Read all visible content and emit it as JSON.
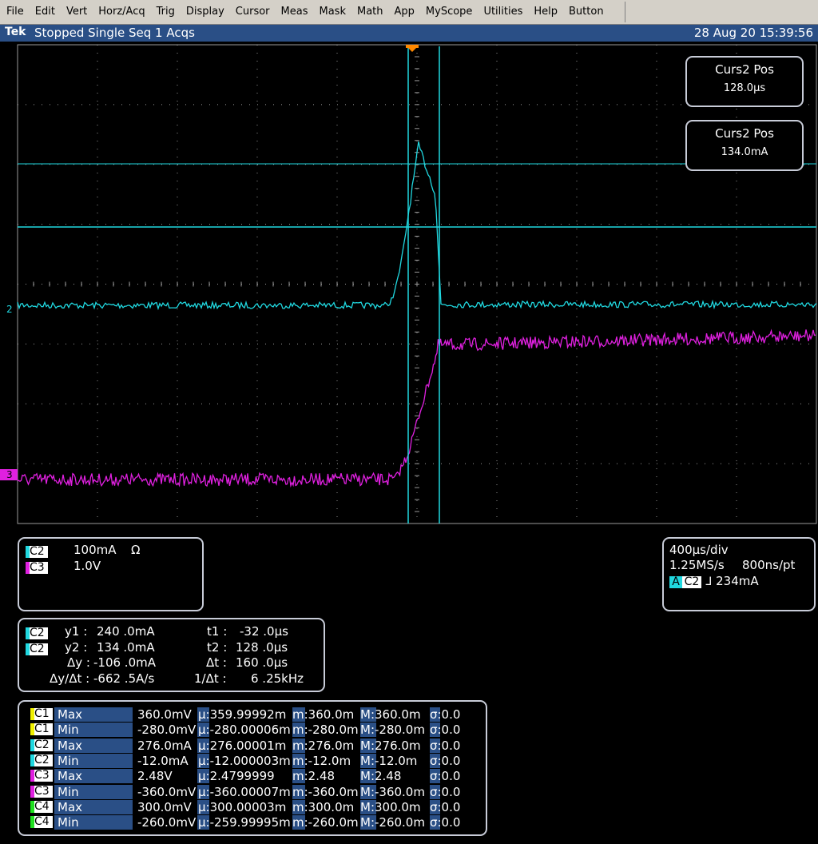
{
  "menu": [
    "File",
    "Edit",
    "Vert",
    "Horz/Acq",
    "Trig",
    "Display",
    "Cursor",
    "Meas",
    "Mask",
    "Math",
    "App",
    "MyScope",
    "Utilities",
    "Help",
    "Button"
  ],
  "status": {
    "brand": "Tek",
    "text": "Stopped Single Seq 1 Acqs",
    "timestamp": "28 Aug 20 15:39:56"
  },
  "channel_markers": {
    "ch2": "2",
    "ch3": "3"
  },
  "colors": {
    "ch1": "#f0f000",
    "ch2": "#20d8e0",
    "ch3": "#e020e0",
    "ch4": "#20e020",
    "trigger": "#ff8800"
  },
  "cursor_readouts": [
    {
      "title": "Curs2 Pos",
      "value": "128.0µs"
    },
    {
      "title": "Curs2 Pos",
      "value": "134.0mA"
    }
  ],
  "vertical": [
    {
      "badge": "C2",
      "scale": "100mA",
      "unit_symbol": "Ω"
    },
    {
      "badge": "C3",
      "scale": "1.0V",
      "unit_symbol": ""
    }
  ],
  "horizontal": {
    "timebase": "400µs/div",
    "sample_rate": "1.25MS/s",
    "resolution": "800ns/pt",
    "trig_mode": "A",
    "trig_source": "C2",
    "trig_slope": "ᒧ",
    "trig_level": "234mA"
  },
  "cursors": {
    "y1": {
      "badge": "C2",
      "label": "y1 :",
      "value": "240 .0mA"
    },
    "y2": {
      "badge": "C2",
      "label": "y2 :",
      "value": "134 .0mA"
    },
    "dy": {
      "label": "Δy :",
      "value": "-106 .0mA"
    },
    "dydt": {
      "label": "Δy/Δt :",
      "value": "-662 .5A/s"
    },
    "t1": {
      "label": "t1 :",
      "value": "-32 .0µs"
    },
    "t2": {
      "label": "t2 :",
      "value": "128 .0µs"
    },
    "dt": {
      "label": "Δt :",
      "value": "160 .0µs"
    },
    "inv_dt": {
      "label": "1/Δt :",
      "value": "6 .25kHz"
    }
  },
  "measurements": [
    {
      "ch": "C1",
      "type": "Max",
      "value": "360.0mV",
      "mean": "µ:359.99992m",
      "min": "m:360.0m",
      "max": "M:360.0m",
      "std": "σ:0.0"
    },
    {
      "ch": "C1",
      "type": "Min",
      "value": "-280.0mV",
      "mean": "µ:-280.00006m",
      "min": "m:-280.0m",
      "max": "M:-280.0m",
      "std": "σ:0.0"
    },
    {
      "ch": "C2",
      "type": "Max",
      "value": "276.0mA",
      "mean": "µ:276.00001m",
      "min": "m:276.0m",
      "max": "M:276.0m",
      "std": "σ:0.0"
    },
    {
      "ch": "C2",
      "type": "Min",
      "value": "-12.0mA",
      "mean": "µ:-12.000003m",
      "min": "m:-12.0m",
      "max": "M:-12.0m",
      "std": "σ:0.0"
    },
    {
      "ch": "C3",
      "type": "Max",
      "value": "2.48V",
      "mean": "µ:2.4799999",
      "min": "m:2.48",
      "max": "M:2.48",
      "std": "σ:0.0"
    },
    {
      "ch": "C3",
      "type": "Min",
      "value": "-360.0mV",
      "mean": "µ:-360.00007m",
      "min": "m:-360.0m",
      "max": "M:-360.0m",
      "std": "σ:0.0"
    },
    {
      "ch": "C4",
      "type": "Max",
      "value": "300.0mV",
      "mean": "µ:300.00003m",
      "min": "m:300.0m",
      "max": "M:300.0m",
      "std": "σ:0.0"
    },
    {
      "ch": "C4",
      "type": "Min",
      "value": "-260.0mV",
      "mean": "µ:-259.99995m",
      "min": "m:-260.0m",
      "max": "M:-260.0m",
      "std": "σ:0.0"
    }
  ]
}
